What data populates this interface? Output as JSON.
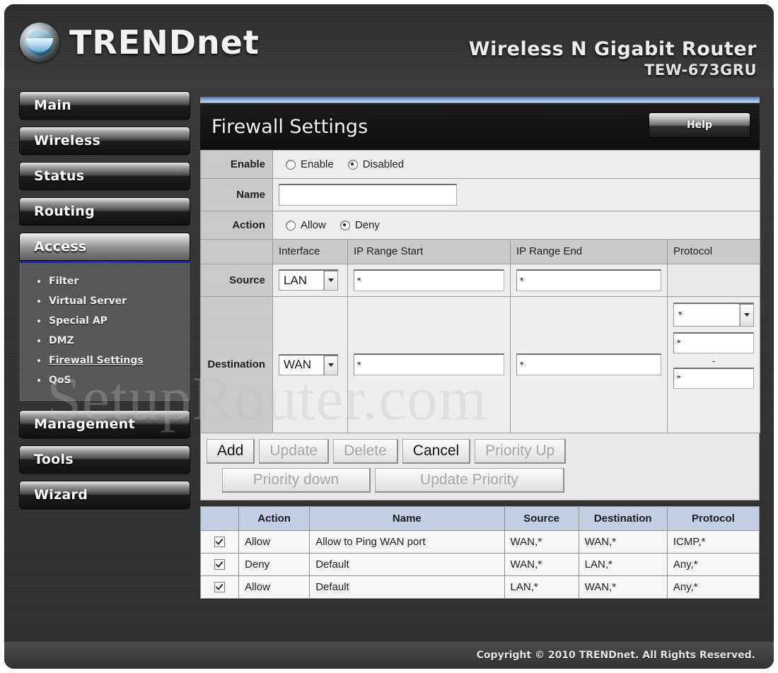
{
  "header": {
    "brand": "TRENDnet",
    "product_name": "Wireless N Gigabit Router",
    "model_number": "TEW-673GRU",
    "logo_icon": "trendnet-globe-icon"
  },
  "sidebar": {
    "items": [
      {
        "label": "Main",
        "active": false
      },
      {
        "label": "Wireless",
        "active": false
      },
      {
        "label": "Status",
        "active": false
      },
      {
        "label": "Routing",
        "active": false
      },
      {
        "label": "Access",
        "active": true
      },
      {
        "label": "Management",
        "active": false
      },
      {
        "label": "Tools",
        "active": false
      },
      {
        "label": "Wizard",
        "active": false
      }
    ],
    "submenu": [
      {
        "label": "Filter",
        "current": false
      },
      {
        "label": "Virtual Server",
        "current": false
      },
      {
        "label": "Special AP",
        "current": false
      },
      {
        "label": "DMZ",
        "current": false
      },
      {
        "label": "Firewall Settings",
        "current": true
      },
      {
        "label": "QoS",
        "current": false
      }
    ],
    "accent_color": "#2b2bff"
  },
  "panel": {
    "title": "Firewall Settings",
    "help_label": "Help"
  },
  "form": {
    "enable": {
      "row_label": "Enable",
      "options": [
        {
          "label": "Enable",
          "checked": false
        },
        {
          "label": "Disabled",
          "checked": true
        }
      ]
    },
    "name": {
      "row_label": "Name",
      "value": "",
      "placeholder": ""
    },
    "action": {
      "row_label": "Action",
      "options": [
        {
          "label": "Allow",
          "checked": false
        },
        {
          "label": "Deny",
          "checked": true
        }
      ]
    },
    "column_headers": {
      "interface": "Interface",
      "ip_range_start": "IP Range Start",
      "ip_range_end": "IP Range End",
      "protocol": "Protocol"
    },
    "source": {
      "row_label": "Source",
      "interface": "LAN",
      "ip_start": "*",
      "ip_end": "*"
    },
    "destination": {
      "row_label": "Destination",
      "interface": "WAN",
      "ip_start": "*",
      "ip_end": "*",
      "protocol": "*",
      "port_start": "*",
      "port_end": "*",
      "port_separator": "-"
    }
  },
  "buttons": [
    {
      "label": "Add",
      "enabled": true
    },
    {
      "label": "Update",
      "enabled": false
    },
    {
      "label": "Delete",
      "enabled": false
    },
    {
      "label": "Cancel",
      "enabled": true
    },
    {
      "label": "Priority Up",
      "enabled": false
    },
    {
      "label": "Priority down",
      "enabled": false
    },
    {
      "label": "Update Priority",
      "enabled": false
    }
  ],
  "rules_table": {
    "headers": [
      "",
      "Action",
      "Name",
      "Source",
      "Destination",
      "Protocol"
    ],
    "rows": [
      {
        "checked": true,
        "action": "Allow",
        "name": "Allow to Ping WAN port",
        "source": "WAN,*",
        "destination": "WAN,*",
        "protocol": "ICMP,*"
      },
      {
        "checked": true,
        "action": "Deny",
        "name": "Default",
        "source": "WAN,*",
        "destination": "LAN,*",
        "protocol": "Any,*"
      },
      {
        "checked": true,
        "action": "Allow",
        "name": "Default",
        "source": "LAN,*",
        "destination": "WAN,*",
        "protocol": "Any,*"
      }
    ]
  },
  "footer": {
    "copyright": "Copyright © 2010 TRENDnet. All Rights Reserved."
  },
  "watermark": {
    "text": "SetupRouter.com"
  }
}
